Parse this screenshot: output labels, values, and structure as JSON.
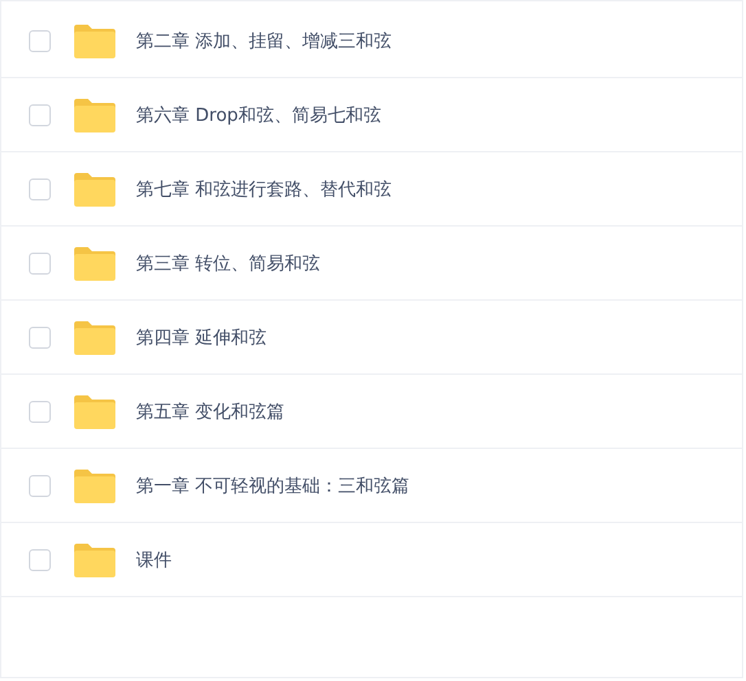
{
  "files": [
    {
      "name": "第二章 添加、挂留、增减三和弦",
      "checked": false
    },
    {
      "name": "第六章 Drop和弦、简易七和弦",
      "checked": false
    },
    {
      "name": "第七章 和弦进行套路、替代和弦",
      "checked": false
    },
    {
      "name": "第三章 转位、简易和弦",
      "checked": false
    },
    {
      "name": "第四章 延伸和弦",
      "checked": false
    },
    {
      "name": "第五章 变化和弦篇",
      "checked": false
    },
    {
      "name": "第一章 不可轻视的基础：三和弦篇",
      "checked": false
    },
    {
      "name": "课件",
      "checked": false
    }
  ]
}
